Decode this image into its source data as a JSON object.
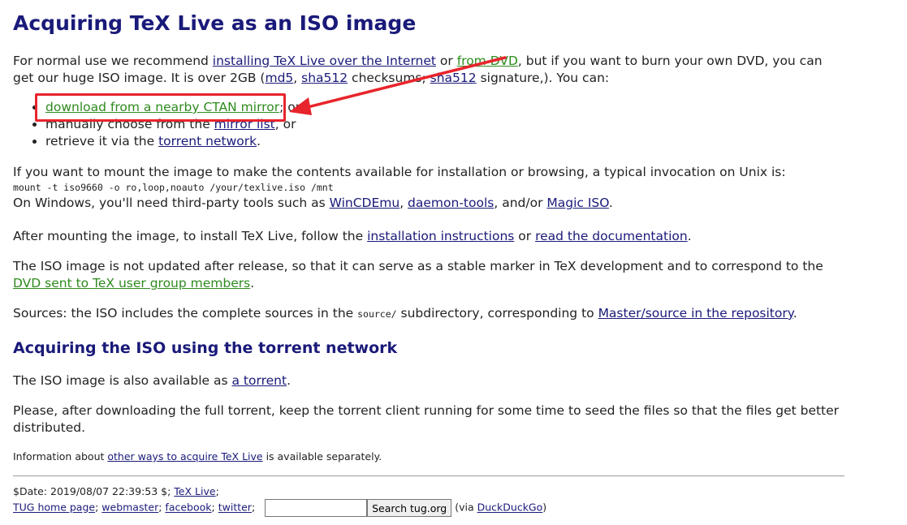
{
  "title": "Acquiring TeX Live as an ISO image",
  "intro": {
    "t1": "For normal use we recommend ",
    "link_internet": "installing TeX Live over the Internet",
    "t2": " or ",
    "link_dvd": "from DVD",
    "t3": ", but if you want to burn your own DVD, you can get our huge ISO image. It is over 2GB (",
    "link_md5": "md5",
    "t4": ", ",
    "link_sha512": "sha512",
    "t5": " checksums; ",
    "link_sha512sig": "sha512",
    "t6": " signature,). You can:"
  },
  "options": {
    "item1_link": "download from a nearby CTAN mirror",
    "item1_suffix": "; or",
    "item2_prefix": "manually choose from the ",
    "item2_link": "mirror list",
    "item2_suffix": ", or",
    "item3_prefix": "retrieve it via the ",
    "item3_link": "torrent network",
    "item3_suffix": "."
  },
  "mount": {
    "text": "If you want to mount the image to make the contents available for installation or browsing, a typical invocation on Unix is:",
    "command": "mount -t iso9660 -o ro,loop,noauto /your/texlive.iso /mnt",
    "windows_prefix": "On Windows, you'll need third-party tools such as ",
    "link_wincdemu": "WinCDEmu",
    "sep1": ", ",
    "link_daemon": "daemon-tools",
    "sep2": ", and/or ",
    "link_magic": "Magic ISO",
    "end": "."
  },
  "install": {
    "t1": "After mounting the image, to install TeX Live, follow the ",
    "link_instructions": "installation instructions",
    "t2": " or ",
    "link_docs": "read the documentation",
    "t3": "."
  },
  "stable": {
    "t1": "The ISO image is not updated after release, so that it can serve as a stable marker in TeX development and to correspond to the ",
    "link_dvd_members": "DVD sent to TeX user group members",
    "t2": "."
  },
  "sources": {
    "t1": "Sources: the ISO includes the complete sources in the ",
    "code": "source/",
    "t2": " subdirectory, corresponding to ",
    "link_repo": "Master/source in the repository",
    "t3": "."
  },
  "torrent_section": {
    "heading": "Acquiring the ISO using the torrent network",
    "p1_prefix": "The ISO image is also available as ",
    "p1_link": "a torrent",
    "p1_suffix": ".",
    "p2": "Please, after downloading the full torrent, keep the torrent client running for some time to seed the files so that the files get better distributed."
  },
  "other_ways": {
    "prefix": "Information about ",
    "link": "other ways to acquire TeX Live",
    "suffix": " is available separately."
  },
  "footer": {
    "date": "$Date: 2019/08/07 22:39:53 $; ",
    "link_texlive": "TeX Live",
    "semi": ";",
    "link_tug": "TUG home page",
    "link_webmaster": "webmaster",
    "link_facebook": "facebook",
    "link_twitter": "twitter",
    "search_value": "",
    "search_button": "Search tug.org",
    "via_prefix": " (via ",
    "link_ddg": "DuckDuckGo",
    "via_suffix": ")"
  },
  "colors": {
    "heading": "#1a1a7a",
    "link": "#1a1a7a",
    "visited_link": "#2e8b1e",
    "annotation": "#e8242c"
  }
}
